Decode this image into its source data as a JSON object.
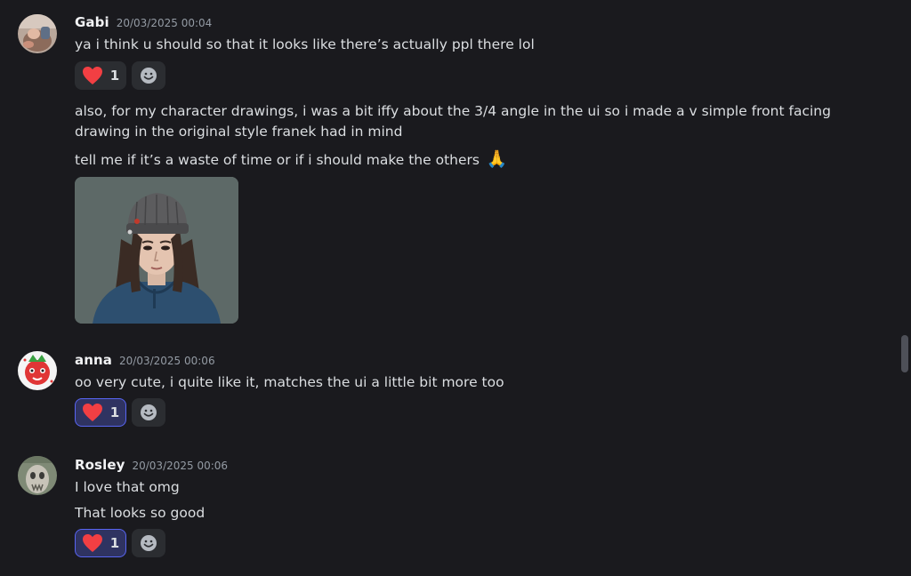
{
  "messages": [
    {
      "username": "Gabi",
      "timestamp": "20/03/2025 00:04",
      "lines": [
        "ya i think u should so that it looks like there’s actually ppl there lol",
        "also, for my character drawings, i was a bit iffy about the 3/4 angle in the ui so i made a v simple front facing",
        "drawing in the original style franek had in mind",
        "tell me if it’s a waste of time or if i should make the others"
      ],
      "emoji": "🙏",
      "reaction": {
        "icon": "heart-icon",
        "count": "1",
        "reacted_by_me": false
      },
      "attachment": {
        "kind": "character-drawing"
      }
    },
    {
      "username": "anna",
      "timestamp": "20/03/2025 00:06",
      "lines": [
        "oo very cute, i quite like it, matches the ui a little bit more too"
      ],
      "reaction": {
        "icon": "heart-icon",
        "count": "1",
        "reacted_by_me": true
      }
    },
    {
      "username": "Rosley",
      "timestamp": "20/03/2025 00:06",
      "lines": [
        "I love that omg",
        "That looks so good"
      ],
      "reaction": {
        "icon": "heart-icon",
        "count": "1",
        "reacted_by_me": true
      }
    }
  ],
  "colors": {
    "background": "#1a1a1e",
    "reaction_bg": "#2b2d31",
    "reaction_selected_bg": "#2f3361",
    "reaction_selected_border": "#5865f2",
    "heart": "#f23f43",
    "timestamp": "#949ba4"
  }
}
